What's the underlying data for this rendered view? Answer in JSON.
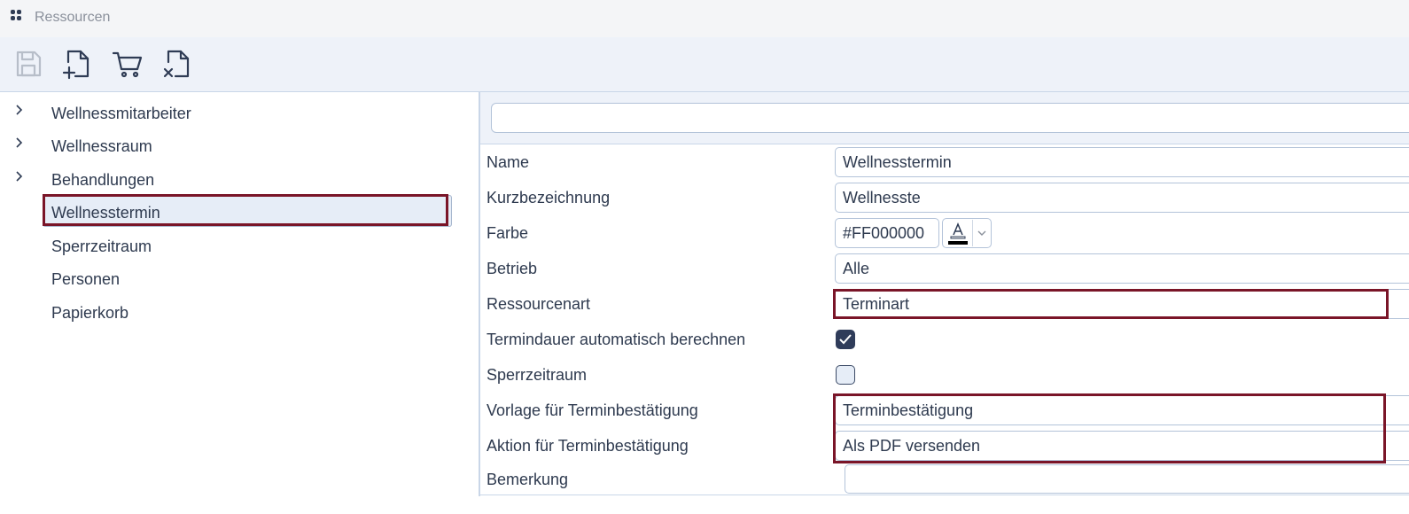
{
  "window": {
    "title": "Ressourcen"
  },
  "toolbar": {
    "buttons": [
      {
        "name": "save",
        "icon": "save-icon",
        "enabled": false
      },
      {
        "name": "new",
        "icon": "file-plus-icon",
        "enabled": true
      },
      {
        "name": "cart",
        "icon": "cart-icon",
        "enabled": true
      },
      {
        "name": "delete",
        "icon": "file-x-icon",
        "enabled": true
      }
    ]
  },
  "tree": {
    "items": [
      {
        "label": "Wellnessmitarbeiter",
        "expandable": true
      },
      {
        "label": "Wellnessraum",
        "expandable": true
      },
      {
        "label": "Behandlungen",
        "expandable": true
      },
      {
        "label": "Wellnesstermin",
        "expandable": false,
        "selected": true
      },
      {
        "label": "Sperrzeitraum",
        "expandable": false
      },
      {
        "label": "Personen",
        "expandable": false
      },
      {
        "label": "Papierkorb",
        "expandable": false
      }
    ]
  },
  "form": {
    "search_value": "",
    "name": {
      "label": "Name",
      "value": "Wellnesstermin"
    },
    "kurz": {
      "label": "Kurzbezeichnung",
      "value": "Wellnesste"
    },
    "farbe": {
      "label": "Farbe",
      "value": "#FF000000"
    },
    "betrieb": {
      "label": "Betrieb",
      "value": "Alle"
    },
    "ressourcenart": {
      "label": "Ressourcenart",
      "value": "Terminart"
    },
    "termindauer": {
      "label": "Termindauer automatisch berechnen",
      "checked": true
    },
    "sperrzeitraum": {
      "label": "Sperrzeitraum",
      "checked": false
    },
    "vorlage": {
      "label": "Vorlage für Terminbestätigung",
      "value": "Terminbestätigung"
    },
    "aktion": {
      "label": "Aktion für Terminbestätigung",
      "value": "Als PDF versenden"
    },
    "bemerkung": {
      "label": "Bemerkung",
      "value": ""
    }
  },
  "colors": {
    "accent": "#2f3c5a",
    "highlight": "#7a1528",
    "toolbar_bg": "#eef2f9"
  }
}
